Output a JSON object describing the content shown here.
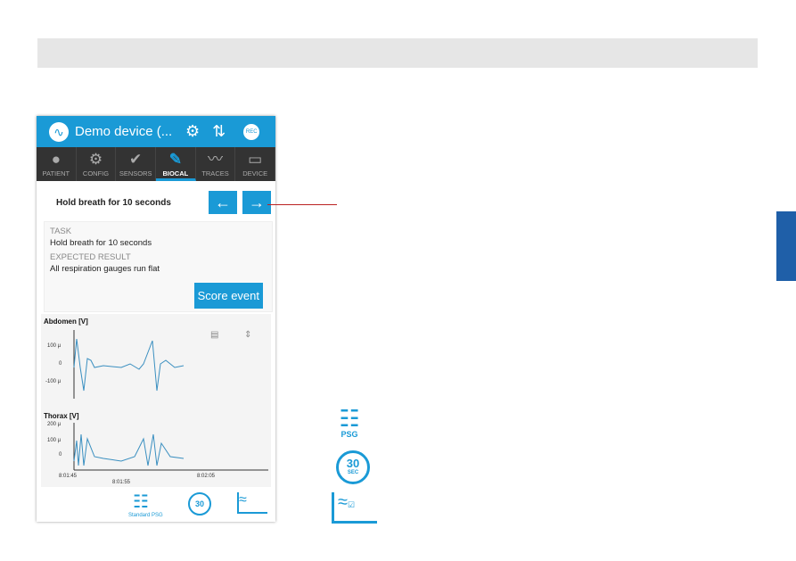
{
  "app": {
    "title": "Demo device (...",
    "rec": "REC"
  },
  "tabs": [
    {
      "label": "PATIENT",
      "icon": "person-icon"
    },
    {
      "label": "CONFIG",
      "icon": "gear-icon"
    },
    {
      "label": "SENSORS",
      "icon": "check-icon"
    },
    {
      "label": "BIOCAL",
      "icon": "pencil-icon",
      "active": true
    },
    {
      "label": "TRACES",
      "icon": "wave-icon"
    },
    {
      "label": "DEVICE",
      "icon": "device-icon"
    }
  ],
  "biocal": {
    "selected": "Hold breath for 10 seconds",
    "prev": "←",
    "next": "→",
    "task_label": "TASK",
    "task": "Hold breath for 10 seconds",
    "expected_label": "EXPECTED RESULT",
    "expected": "All respiration gauges run flat",
    "score": "Score event"
  },
  "plots": {
    "abdomen": "Abdomen [V]",
    "thorax": "Thorax [V]",
    "abd_ticks": [
      "100 µ",
      "0",
      "-100 µ"
    ],
    "tho_ticks": [
      "200 µ",
      "100 µ",
      "0"
    ],
    "time_ticks": [
      "8:01:45",
      "8:01:55",
      "8:02:05"
    ]
  },
  "bottom": {
    "psg_label": "Standard PSG",
    "timer": "30"
  },
  "legend": {
    "psg": "PSG",
    "timer": "30",
    "sec": "SEC"
  },
  "colors": {
    "accent": "#1a9ad6",
    "dark": "#333333"
  }
}
